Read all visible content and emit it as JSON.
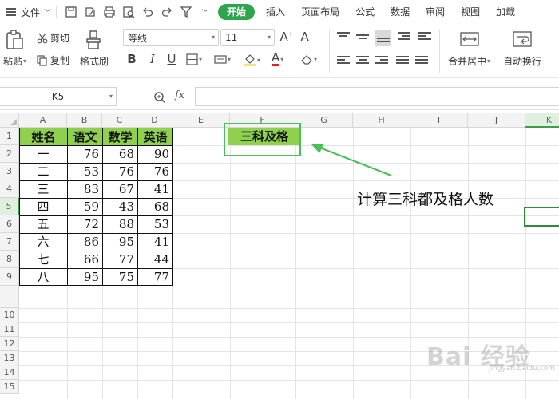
{
  "menubar": {
    "file_label": "文件",
    "tabs": [
      "开始",
      "插入",
      "页面布局",
      "公式",
      "数据",
      "审阅",
      "视图",
      "加载"
    ],
    "active_tab": 0
  },
  "ribbon": {
    "paste": "粘贴",
    "cut": "剪切",
    "copy": "复制",
    "format_painter": "格式刷",
    "font_name": "等线",
    "font_size": "11",
    "merge_center": "合并居中",
    "wrap_text": "自动换行"
  },
  "formula_bar": {
    "name_box": "K5",
    "fx": "fx",
    "formula": ""
  },
  "grid": {
    "columns": [
      "A",
      "B",
      "C",
      "D",
      "E",
      "F",
      "G",
      "H",
      "I",
      "J",
      "K"
    ],
    "rows": [
      "1",
      "2",
      "3",
      "4",
      "5",
      "6",
      "7",
      "8",
      "9",
      "10",
      "11",
      "12",
      "13",
      "14",
      "15"
    ],
    "selected_column": "K",
    "selected_row": "5",
    "headers": [
      "姓名",
      "语文",
      "数学",
      "英语"
    ],
    "table": [
      [
        "一",
        "76",
        "68",
        "90"
      ],
      [
        "二",
        "53",
        "76",
        "76"
      ],
      [
        "三",
        "83",
        "67",
        "41"
      ],
      [
        "四",
        "59",
        "43",
        "68"
      ],
      [
        "五",
        "72",
        "88",
        "53"
      ],
      [
        "六",
        "86",
        "95",
        "41"
      ],
      [
        "七",
        "66",
        "77",
        "44"
      ],
      [
        "八",
        "95",
        "75",
        "77"
      ]
    ],
    "f1_label": "三科及格"
  },
  "annotation": "计算三科都及格人数",
  "watermark": {
    "main": "Bai 经验",
    "sub": "jingyan.baidu.com"
  },
  "colors": {
    "accent": "#2da44e",
    "header_fill": "#8fd14f",
    "annotation": "#4dbf5a"
  }
}
